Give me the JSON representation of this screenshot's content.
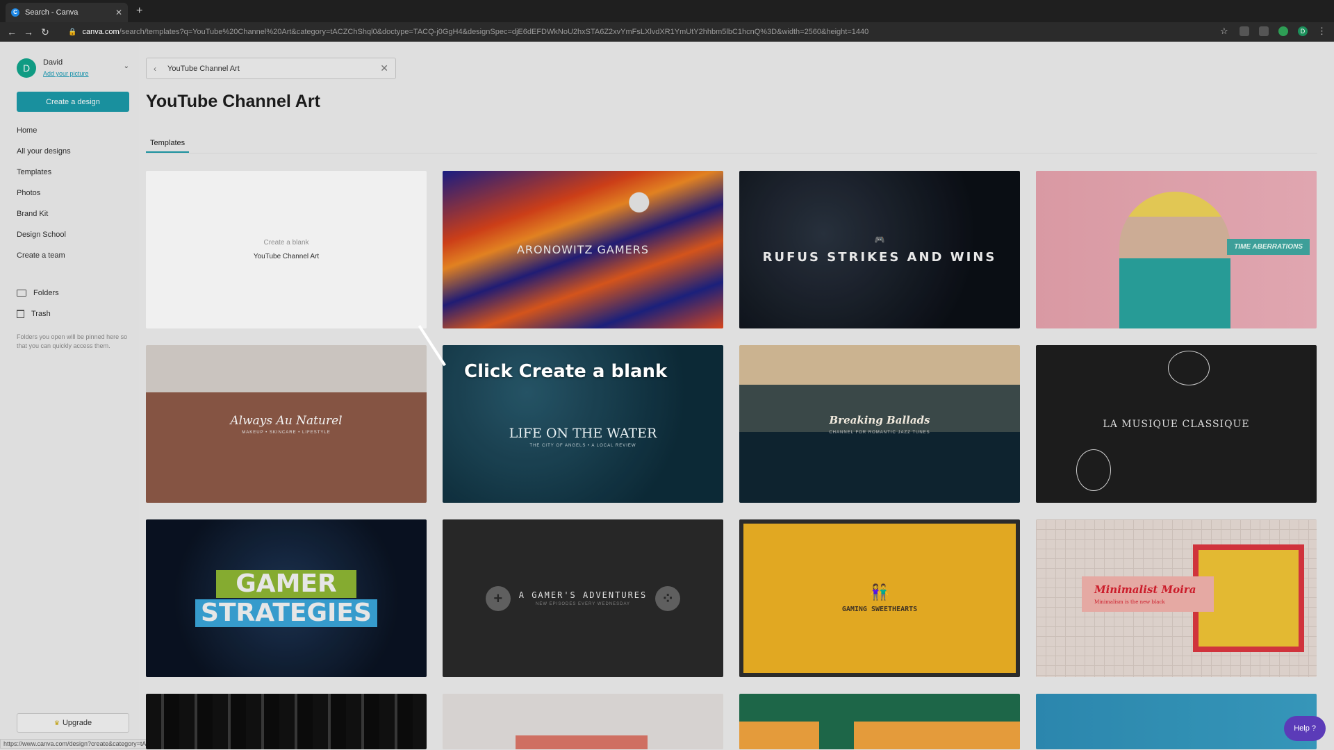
{
  "browser": {
    "tab_title": "Search - Canva",
    "url_host": "canva.com",
    "url_rest": "/search/templates?q=YouTube%20Channel%20Art&category=tACZChShql0&doctype=TACQ-j0GgH4&designSpec=djE6dEFDWkNoU2hxSTA6Z2xvYmFsLXlvdXR1YmUtY2hhbm5lbC1hcnQ%3D&width=2560&height=1440",
    "status_url": "https://www.canva.com/design?create&category=tACZChShql0&type=TACQ-j0GgH4&media=MAC38tc2nFA&schema=web-2"
  },
  "sidebar": {
    "user_name": "David",
    "user_initial": "D",
    "add_picture": "Add your picture",
    "create_button": "Create a design",
    "nav": [
      "Home",
      "All your designs",
      "Templates",
      "Photos",
      "Brand Kit",
      "Design School",
      "Create a team"
    ],
    "folders": "Folders",
    "trash": "Trash",
    "folders_note": "Folders you open will be pinned here so that you can quickly access them.",
    "upgrade": "Upgrade"
  },
  "search": {
    "value": "YouTube Channel Art"
  },
  "main": {
    "title": "YouTube Channel Art",
    "tab": "Templates"
  },
  "blank_card": {
    "line1": "Create a blank",
    "line2": "YouTube Channel Art"
  },
  "templates": {
    "aronowitz": "ARONOWITZ GAMERS",
    "rufus": "RUFUS STRIKES AND WINS",
    "time": "TIME ABERRATIONS",
    "natural": "Always Au Naturel",
    "natural_sub": "MAKEUP • SKINCARE • LIFESTYLE",
    "water": "LIFE ON THE WATER",
    "water_sub": "THE CITY OF ANGELS • A LOCAL REVIEW",
    "ballads": "Breaking Ballads",
    "ballads_sub": "CHANNEL FOR ROMANTIC JAZZ TUNES",
    "musique": "LA MUSIQUE CLASSIQUE",
    "gamer_1": "GAMER",
    "gamer_2": "STRATEGIES",
    "adventures": "A GAMER'S ADVENTURES",
    "adventures_sub": "NEW EPISODES EVERY WEDNESDAY",
    "sweethearts": "GAMING SWEETHEARTS",
    "moira_title": "Minimalist Moira",
    "moira_sub": "Minimalism is the new black"
  },
  "callout": "Click Create a blank",
  "help": "Help ?"
}
